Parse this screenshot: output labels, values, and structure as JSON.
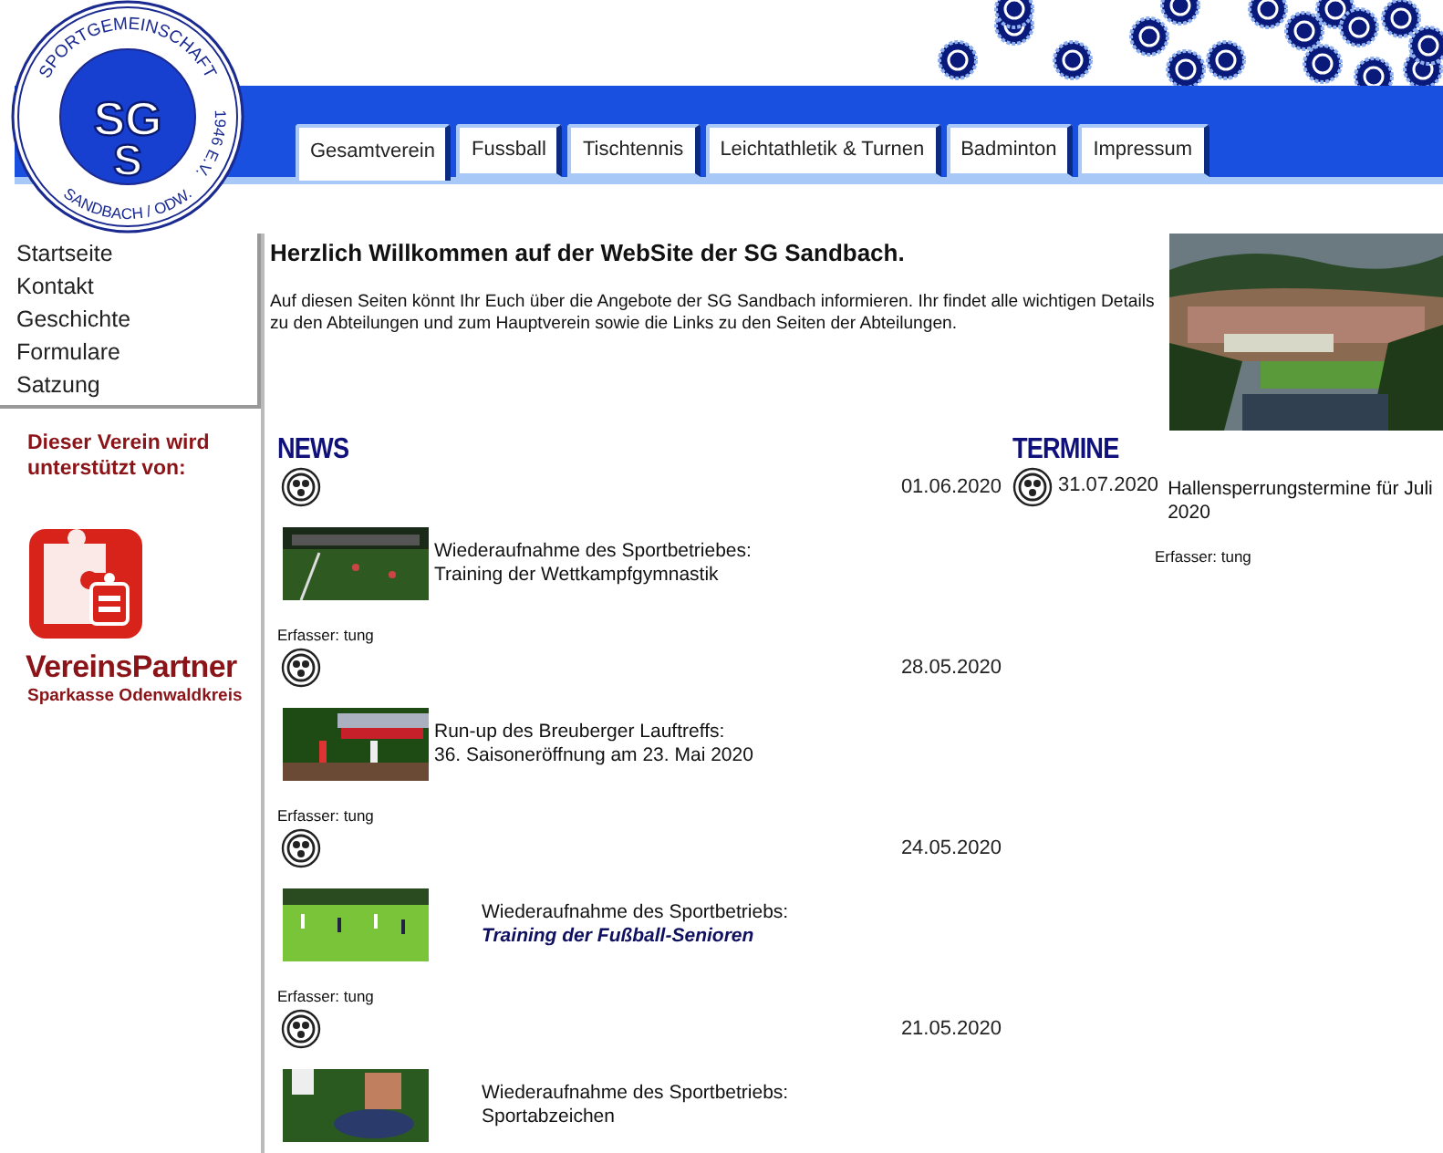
{
  "logo": {
    "ring_top": "SPORTGEMEINSCHAFT",
    "ring_side": "1946 E.V.",
    "ring_bottom": "SANDBACH / ODW.",
    "initials_top": "SG",
    "initials_bottom": "S"
  },
  "tabs": [
    {
      "label": "Gesamtverein",
      "selected": true
    },
    {
      "label": "Fussball",
      "selected": false
    },
    {
      "label": "Tischtennis",
      "selected": false
    },
    {
      "label": "Leichtathletik & Turnen",
      "selected": false
    },
    {
      "label": "Badminton",
      "selected": false
    },
    {
      "label": "Impressum",
      "selected": false
    }
  ],
  "sidebar": {
    "items": [
      "Startseite",
      "Kontakt",
      "Geschichte",
      "Formulare",
      "Satzung"
    ],
    "sponsor": {
      "heading": "Dieser Verein wird unterstützt von:",
      "name": "VereinsPartner",
      "bank": "Sparkasse Odenwaldkreis"
    }
  },
  "intro": {
    "title": "Herzlich Willkommen auf der WebSite der SG Sandbach.",
    "text": "Auf diesen Seiten könnt Ihr Euch über die Angebote der SG Sandbach informieren. Ihr findet alle wichtigen Details zu den Abteilungen und zum Hauptverein sowie die Links zu den Seiten der Abteilungen."
  },
  "news": {
    "heading": "NEWS",
    "items": [
      {
        "date": "01.06.2020",
        "title": "Wiederaufnahme des Sportbetriebes:",
        "subtitle": "Training der Wettkampfgymnastik",
        "subtitle_emphasis": false,
        "author": "Erfasser: tung"
      },
      {
        "date": "28.05.2020",
        "title": "Run-up des Breuberger Lauftreffs:",
        "subtitle": "36. Saisoneröffnung am 23. Mai 2020",
        "subtitle_emphasis": false,
        "author": "Erfasser: tung"
      },
      {
        "date": "24.05.2020",
        "title": "Wiederaufnahme des Sportbetriebs:",
        "subtitle": "Training der Fußball-Senioren",
        "subtitle_emphasis": true,
        "author": "Erfasser: tung"
      },
      {
        "date": "21.05.2020",
        "title": "Wiederaufnahme des Sportbetriebs:",
        "subtitle": "Sportabzeichen",
        "subtitle_emphasis": false
      }
    ]
  },
  "termine": {
    "heading": "TERMINE",
    "items": [
      {
        "start": "31.07.2020",
        "text": "Hallensperrungstermine für Juli 2020",
        "author": "Erfasser: tung"
      }
    ]
  }
}
